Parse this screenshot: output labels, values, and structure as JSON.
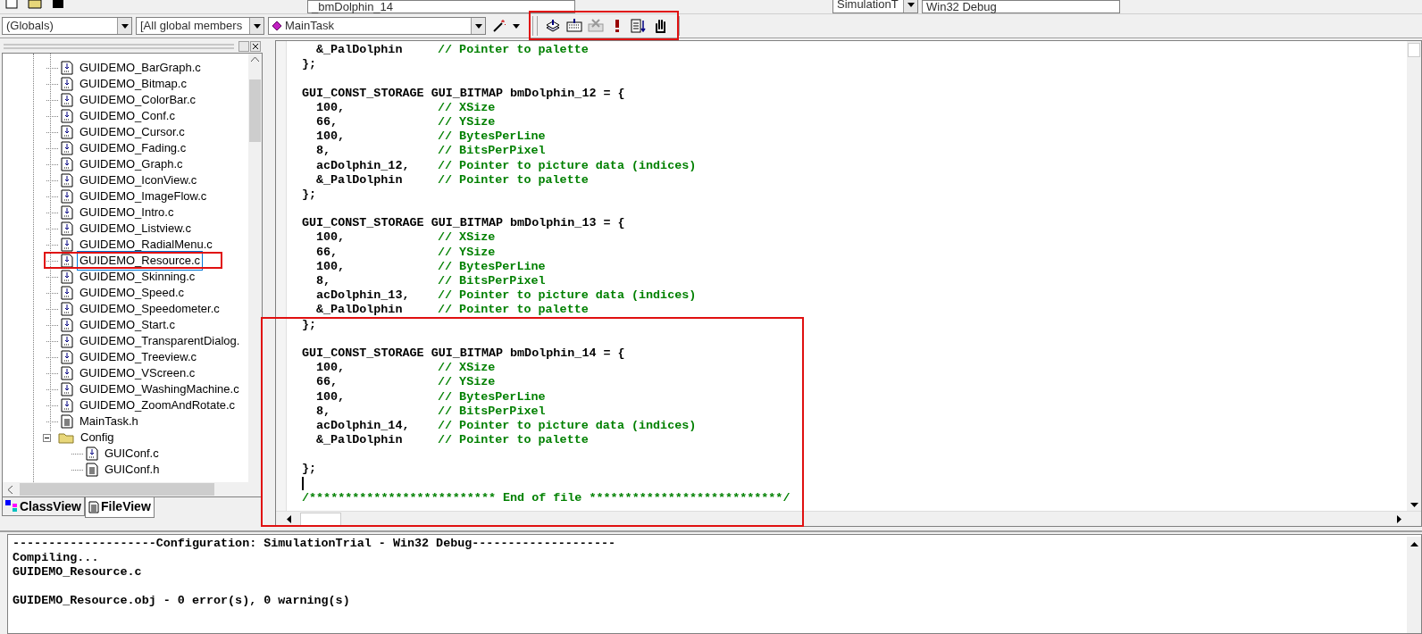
{
  "top_toolbar": {
    "symbol_combo": "_bmDolphin_14",
    "config_combo": "SimulationT",
    "platform_combo": "Win32 Debug"
  },
  "wizard_bar": {
    "class_combo": "(Globals)",
    "filter_combo": "[All global members",
    "member_combo": "MainTask"
  },
  "file_tree": {
    "items": [
      {
        "name": "GUIDEMO_BarGraph.c",
        "kind": "source",
        "selected": false
      },
      {
        "name": "GUIDEMO_Bitmap.c",
        "kind": "source",
        "selected": false
      },
      {
        "name": "GUIDEMO_ColorBar.c",
        "kind": "source",
        "selected": false
      },
      {
        "name": "GUIDEMO_Conf.c",
        "kind": "source",
        "selected": false
      },
      {
        "name": "GUIDEMO_Cursor.c",
        "kind": "source",
        "selected": false
      },
      {
        "name": "GUIDEMO_Fading.c",
        "kind": "source",
        "selected": false
      },
      {
        "name": "GUIDEMO_Graph.c",
        "kind": "source",
        "selected": false
      },
      {
        "name": "GUIDEMO_IconView.c",
        "kind": "source",
        "selected": false
      },
      {
        "name": "GUIDEMO_ImageFlow.c",
        "kind": "source",
        "selected": false
      },
      {
        "name": "GUIDEMO_Intro.c",
        "kind": "source",
        "selected": false
      },
      {
        "name": "GUIDEMO_Listview.c",
        "kind": "source",
        "selected": false
      },
      {
        "name": "GUIDEMO_RadialMenu.c",
        "kind": "source",
        "selected": false
      },
      {
        "name": "GUIDEMO_Resource.c",
        "kind": "source",
        "selected": true
      },
      {
        "name": "GUIDEMO_Skinning.c",
        "kind": "source",
        "selected": false
      },
      {
        "name": "GUIDEMO_Speed.c",
        "kind": "source",
        "selected": false
      },
      {
        "name": "GUIDEMO_Speedometer.c",
        "kind": "source",
        "selected": false
      },
      {
        "name": "GUIDEMO_Start.c",
        "kind": "source",
        "selected": false
      },
      {
        "name": "GUIDEMO_TransparentDialog.",
        "kind": "source",
        "selected": false
      },
      {
        "name": "GUIDEMO_Treeview.c",
        "kind": "source",
        "selected": false
      },
      {
        "name": "GUIDEMO_VScreen.c",
        "kind": "source",
        "selected": false
      },
      {
        "name": "GUIDEMO_WashingMachine.c",
        "kind": "source",
        "selected": false
      },
      {
        "name": "GUIDEMO_ZoomAndRotate.c",
        "kind": "source",
        "selected": false
      },
      {
        "name": "MainTask.h",
        "kind": "header",
        "selected": false
      },
      {
        "name": "Config",
        "kind": "folder",
        "selected": false,
        "expanded": true,
        "children": [
          {
            "name": "GUIConf.c",
            "kind": "source",
            "selected": false
          },
          {
            "name": "GUIConf.h",
            "kind": "header",
            "selected": false
          }
        ]
      }
    ]
  },
  "tabs": [
    {
      "label": "ClassView",
      "selected": false
    },
    {
      "label": "FileView",
      "selected": true
    }
  ],
  "editor": {
    "lines": [
      {
        "kind": "code",
        "indented": true,
        "code": "&_PalDolphin",
        "comment": "// Pointer to palette"
      },
      {
        "kind": "code",
        "code": "};"
      },
      {
        "kind": "blank"
      },
      {
        "kind": "code",
        "code": "GUI_CONST_STORAGE GUI_BITMAP bmDolphin_12 = {"
      },
      {
        "kind": "code",
        "indented": true,
        "code": "100,",
        "comment": "// XSize"
      },
      {
        "kind": "code",
        "indented": true,
        "code": "66,",
        "comment": "// YSize"
      },
      {
        "kind": "code",
        "indented": true,
        "code": "100,",
        "comment": "// BytesPerLine"
      },
      {
        "kind": "code",
        "indented": true,
        "code": "8,",
        "comment": "// BitsPerPixel"
      },
      {
        "kind": "code",
        "indented": true,
        "code": "acDolphin_12,",
        "comment": "// Pointer to picture data (indices)"
      },
      {
        "kind": "code",
        "indented": true,
        "code": "&_PalDolphin",
        "comment": "// Pointer to palette"
      },
      {
        "kind": "code",
        "code": "};"
      },
      {
        "kind": "blank"
      },
      {
        "kind": "code",
        "code": "GUI_CONST_STORAGE GUI_BITMAP bmDolphin_13 = {"
      },
      {
        "kind": "code",
        "indented": true,
        "code": "100,",
        "comment": "// XSize"
      },
      {
        "kind": "code",
        "indented": true,
        "code": "66,",
        "comment": "// YSize"
      },
      {
        "kind": "code",
        "indented": true,
        "code": "100,",
        "comment": "// BytesPerLine"
      },
      {
        "kind": "code",
        "indented": true,
        "code": "8,",
        "comment": "// BitsPerPixel"
      },
      {
        "kind": "code",
        "indented": true,
        "code": "acDolphin_13,",
        "comment": "// Pointer to picture data (indices)"
      },
      {
        "kind": "code",
        "indented": true,
        "code": "&_PalDolphin",
        "comment": "// Pointer to palette"
      },
      {
        "kind": "code",
        "code": "};"
      },
      {
        "kind": "blank"
      },
      {
        "kind": "code",
        "code": "GUI_CONST_STORAGE GUI_BITMAP bmDolphin_14 = {"
      },
      {
        "kind": "code",
        "indented": true,
        "code": "100,",
        "comment": "// XSize"
      },
      {
        "kind": "code",
        "indented": true,
        "code": "66,",
        "comment": "// YSize"
      },
      {
        "kind": "code",
        "indented": true,
        "code": "100,",
        "comment": "// BytesPerLine"
      },
      {
        "kind": "code",
        "indented": true,
        "code": "8,",
        "comment": "// BitsPerPixel"
      },
      {
        "kind": "code",
        "indented": true,
        "code": "acDolphin_14,",
        "comment": "// Pointer to picture data (indices)"
      },
      {
        "kind": "code",
        "indented": true,
        "code": "&_PalDolphin",
        "comment": "// Pointer to palette"
      },
      {
        "kind": "blank"
      },
      {
        "kind": "code",
        "code": "};"
      },
      {
        "kind": "cursor"
      },
      {
        "kind": "code",
        "comment": "/************************** End of file ***************************/"
      }
    ]
  },
  "output": {
    "lines": [
      {
        "text": "--------------------Configuration: SimulationTrial - Win32 Debug--------------------"
      },
      {
        "text": "Compiling..."
      },
      {
        "text": "GUIDEMO_Resource.c"
      },
      {
        "text": "GUIDEMO_Resource.obj - 0 error(s), 0 warning(s)",
        "blank_before": true
      }
    ]
  }
}
